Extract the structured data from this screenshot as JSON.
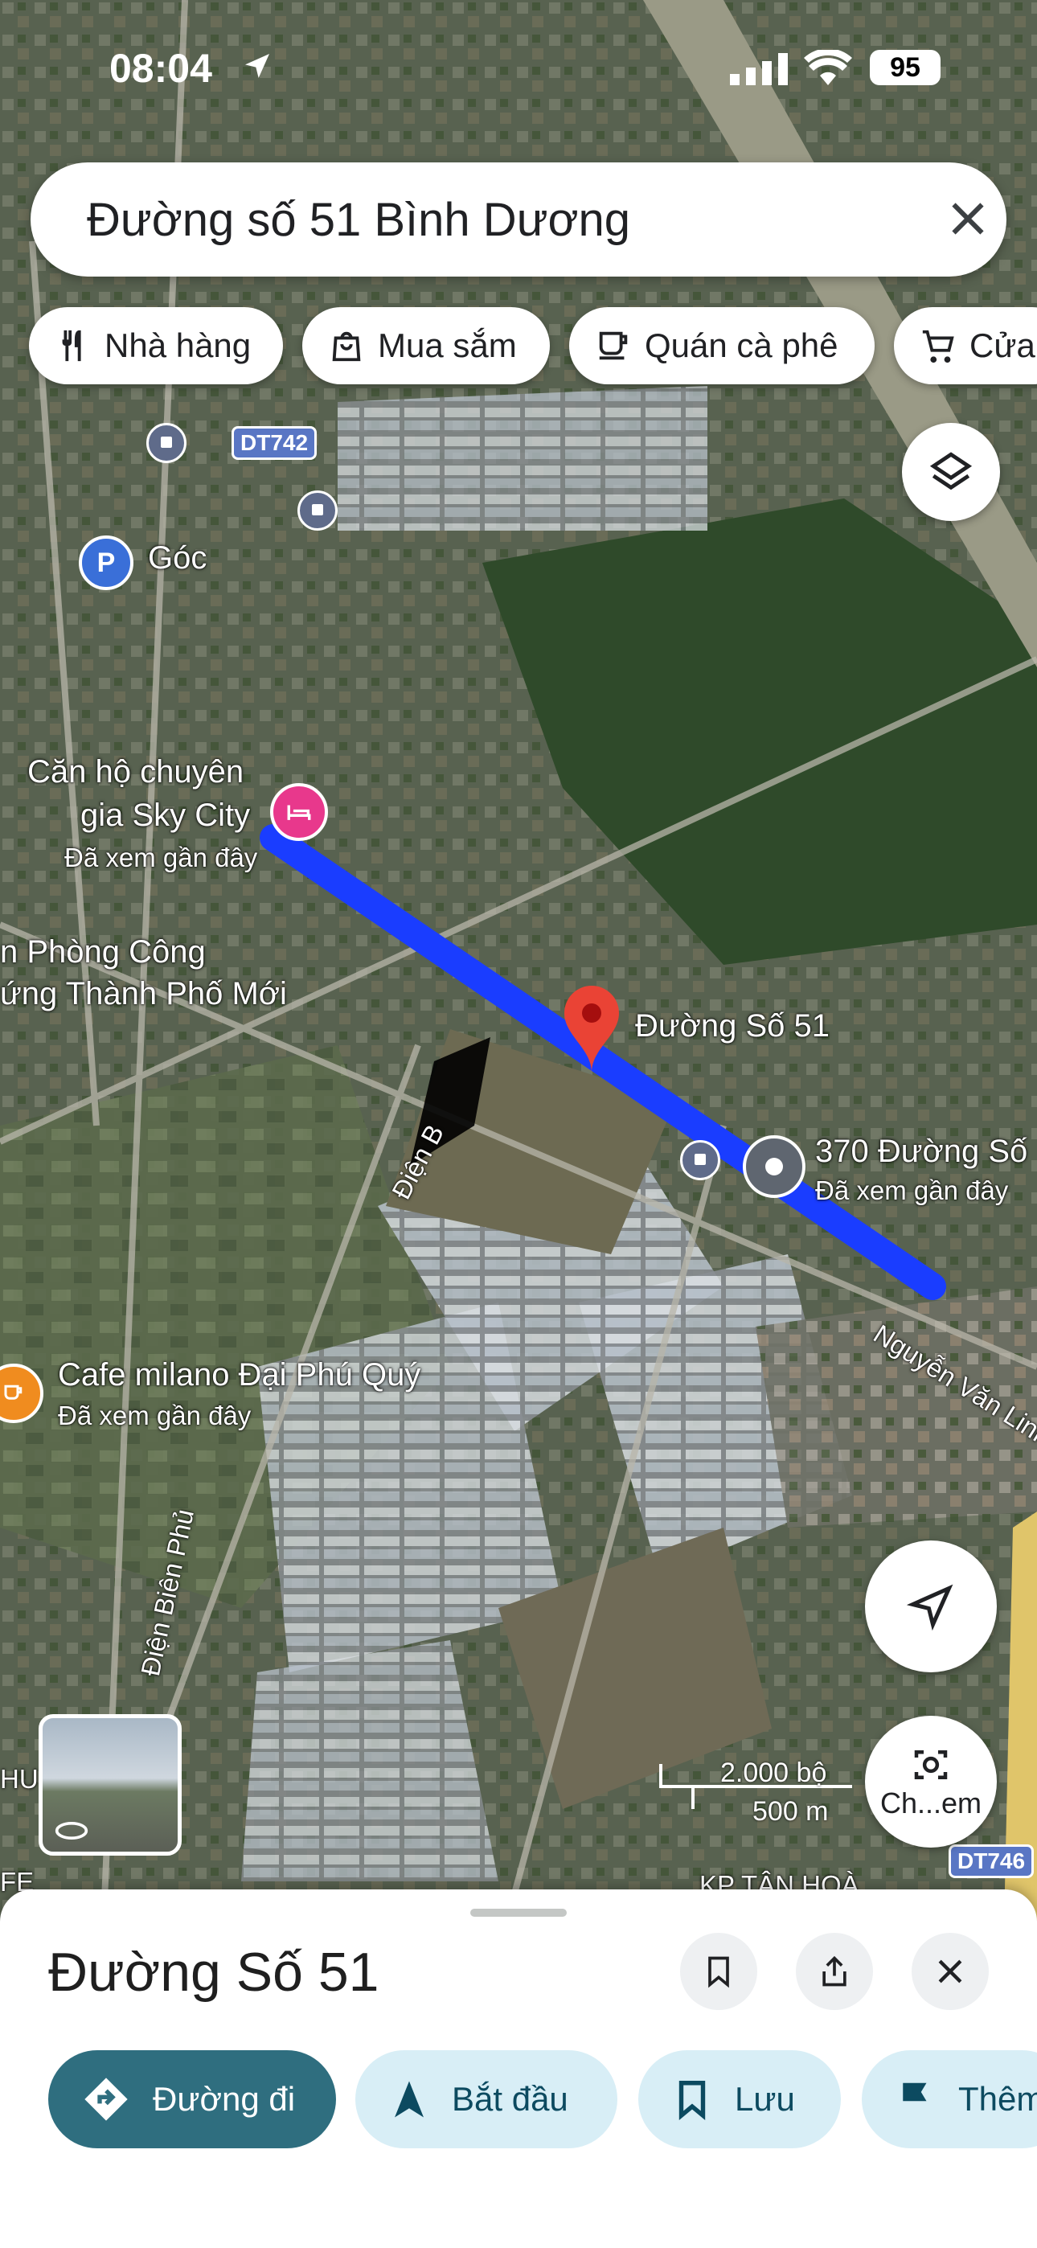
{
  "status_bar": {
    "time": "08:04",
    "battery": "95"
  },
  "search": {
    "query": "Đường số 51 Bình Dương"
  },
  "chips": [
    {
      "label": "Nhà hàng",
      "icon": "fork-knife-icon"
    },
    {
      "label": "Mua sắm",
      "icon": "shopping-bag-icon"
    },
    {
      "label": "Quán cà phê",
      "icon": "coffee-cup-icon"
    },
    {
      "label": "Cửa",
      "icon": "cart-icon"
    }
  ],
  "map": {
    "labels": {
      "goc": "Góc",
      "sky_city_line1": "Căn hộ chuyên",
      "sky_city_line2": "gia Sky City",
      "sky_city_sub": "Đã xem gần đây",
      "phong_cong_line1": "n Phòng Công",
      "phong_cong_line2": "ứng Thành Phố Mới",
      "duong_so_51": "Đường Số 51",
      "addr_370": "370 Đường Số",
      "addr_370_sub": "Đã xem gần đây",
      "cafe": "Cafe milano Đại Phú Quý",
      "cafe_sub": "Đã xem gần đây",
      "nguyen_van_linh": "Nguyễn Văn Linh",
      "dien_bien_1": "Điện B",
      "dien_bien_phu": "Điện Biên Phủ",
      "hu": "HU",
      "fe": "FE",
      "kp": "KP TÂN HOÀ"
    },
    "shields": [
      "DT742",
      "DT746"
    ],
    "scale_imperial": "2.000 bộ",
    "scale_metric": "500 m",
    "camera_label": "Ch...em",
    "colors": {
      "route": "#1a3dff",
      "pin": "#ea4335",
      "hotel": "#e8388c",
      "cafe": "#f08c1f",
      "parking": "#3a6fd8"
    }
  },
  "sheet": {
    "title": "Đường Số 51",
    "actions": [
      {
        "label": "Đường đi",
        "icon": "directions-icon"
      },
      {
        "label": "Bắt đầu",
        "icon": "navigation-arrow-icon"
      },
      {
        "label": "Lưu",
        "icon": "bookmark-icon"
      },
      {
        "label": "Thêm",
        "icon": "flag-icon"
      }
    ]
  }
}
